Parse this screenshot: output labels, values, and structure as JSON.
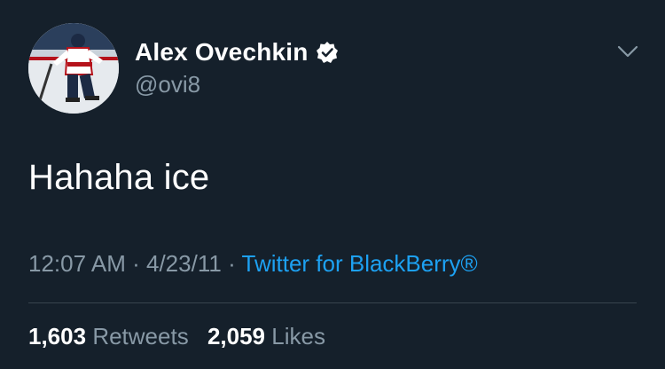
{
  "user": {
    "display_name": "Alex Ovechkin",
    "handle": "@ovi8",
    "verified": true,
    "avatar_icon": "hockey-player-avatar"
  },
  "tweet": {
    "text": "Hahaha ice",
    "time": "12:07 AM",
    "date": "4/23/11",
    "separator": "·",
    "source": "Twitter for BlackBerry®"
  },
  "stats": {
    "retweets_count": "1,603",
    "retweets_label": "Retweets",
    "likes_count": "2,059",
    "likes_label": "Likes"
  },
  "colors": {
    "background": "#15202b",
    "text_primary": "#ffffff",
    "text_secondary": "#8899a6",
    "link": "#1da1f2",
    "divider": "#38444d"
  },
  "icons": {
    "verified": "verified-badge-icon",
    "menu": "chevron-down-icon"
  }
}
